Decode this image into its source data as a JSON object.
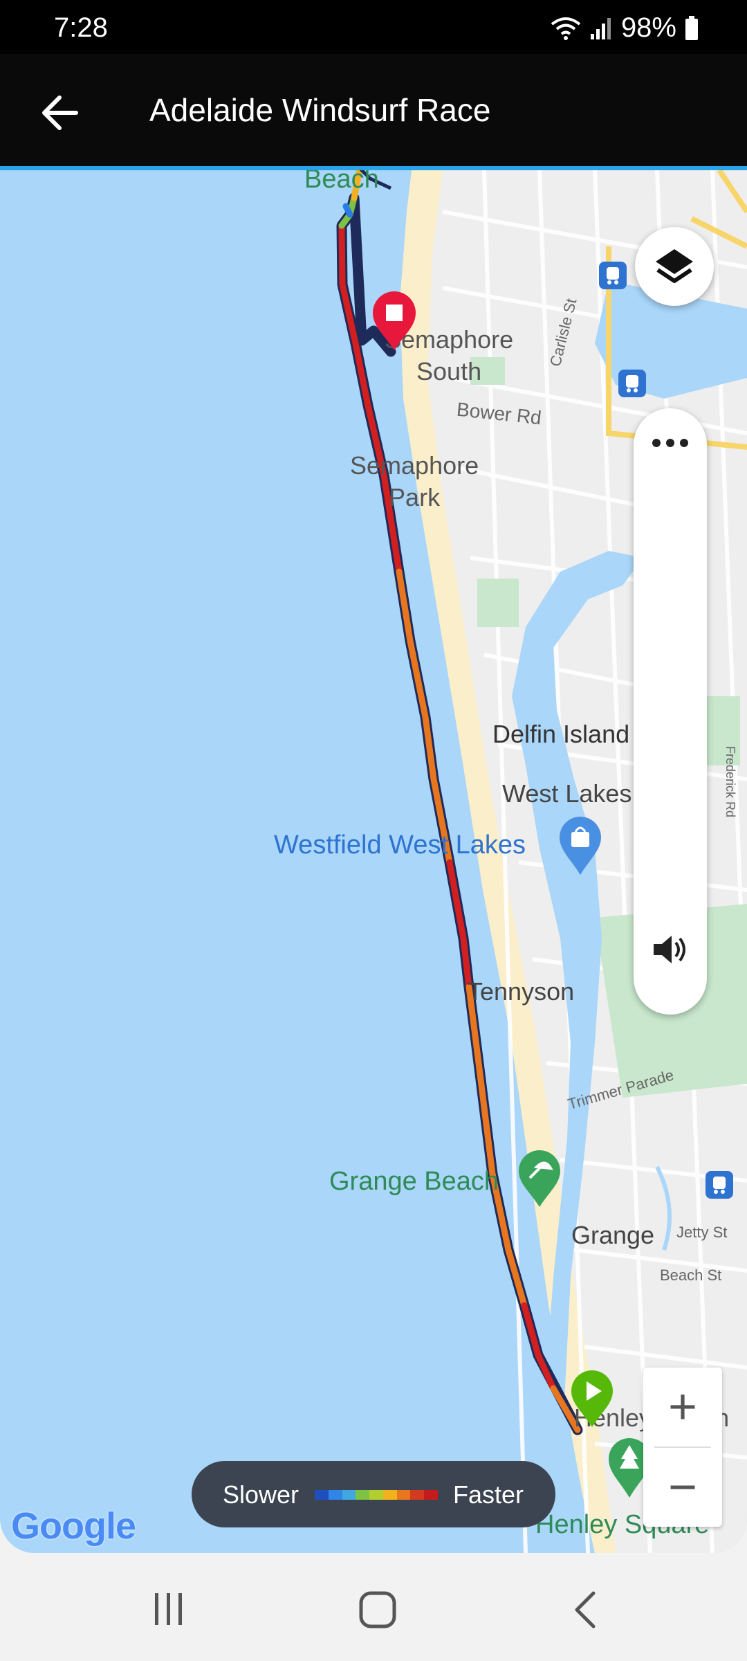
{
  "status_bar": {
    "time": "7:28",
    "battery": "98%"
  },
  "app_bar": {
    "title": "Adelaide Windsurf Race",
    "back_icon": "arrow-left-icon"
  },
  "map": {
    "labels": {
      "beach_top": "Beach",
      "semaphore_south_1": "Semaphore",
      "semaphore_south_2": "South",
      "carlisle_st": "Carlisle St",
      "bower_rd": "Bower Rd",
      "semaphore_park_1": "Semaphore",
      "semaphore_park_2": "Park",
      "delfin_island": "Delfin Island",
      "west_lakes": "West Lakes",
      "westfield": "Westfield West Lakes",
      "frederick_rd": "Frederick Rd",
      "tennyson": "Tennyson",
      "trimmer_parade": "Trimmer Parade",
      "grange_beach": "Grange Beach",
      "grange": "Grange",
      "jetty_st": "Jetty St",
      "beach_st": "Beach St",
      "henley_beach": "Henley Beach",
      "henley_square": "Henley Square"
    },
    "attribution": "Google",
    "colors": {
      "water": "#a9d6f9",
      "land": "#eeeeee",
      "sand": "#fbeecb",
      "park": "#c8e7cc"
    },
    "route_colors": [
      "#1e3a8a",
      "#d21f1f",
      "#e8761e",
      "#f2b21e",
      "#7dc242",
      "#2b7ce9"
    ],
    "markers": {
      "start": "play-marker-icon",
      "finish": "stop-marker-icon"
    }
  },
  "controls": {
    "layers_icon": "layers-icon",
    "more_icon": "more-horizontal-icon",
    "sound_icon": "speaker-icon",
    "zoom_in": "+",
    "zoom_out": "−"
  },
  "legend": {
    "slower": "Slower",
    "faster": "Faster",
    "gradient": [
      "#1f4fbf",
      "#2f86e8",
      "#41a7e0",
      "#7dc242",
      "#b3cf2f",
      "#f2b21e",
      "#e8761e",
      "#d33a1f",
      "#c41c1c"
    ]
  },
  "nav_bar": {
    "recents_icon": "recents-icon",
    "home_icon": "home-icon",
    "back_icon": "nav-back-icon"
  }
}
